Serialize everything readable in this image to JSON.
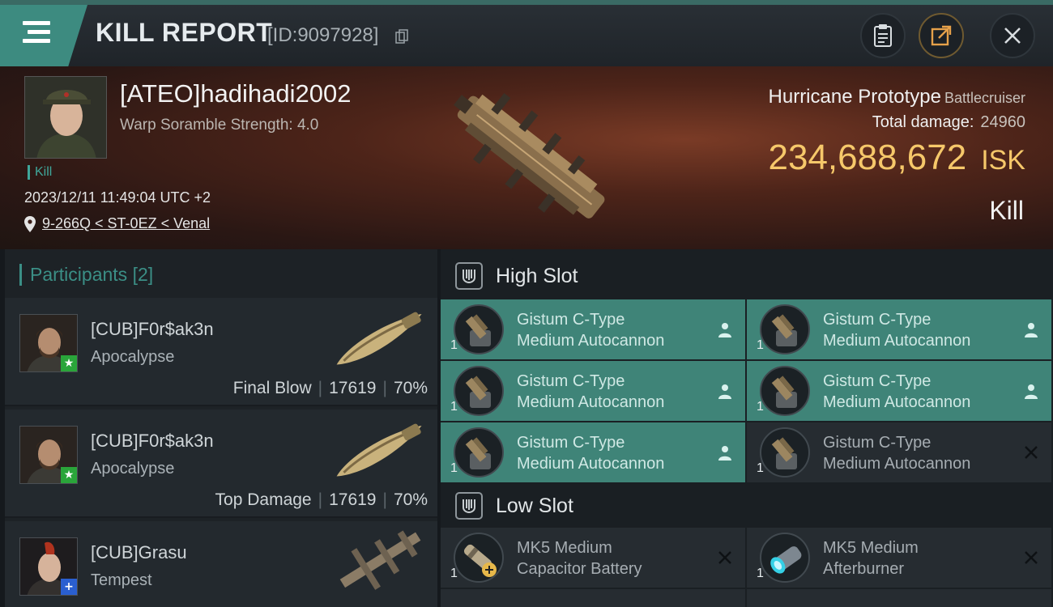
{
  "header": {
    "title": "KILL REPORT",
    "report_id": "[ID:9097928]"
  },
  "victim": {
    "name": "[ATEO]hadihadi2002",
    "warp_scramble": "Warp Soramble Strength: 4.0",
    "kill_tag": "Kill",
    "datetime": "2023/12/11 11:49:04 UTC +2",
    "location": "9-266Q < ST-0EZ < Venal",
    "ship_name": "Hurricane Prototype",
    "ship_class": "Battlecruiser",
    "total_damage_label": "Total damage:",
    "total_damage_value": "24960",
    "isk_value": "234,688,672",
    "isk_unit": "ISK",
    "result": "Kill"
  },
  "participants": {
    "title": "Participants",
    "count": "[2]",
    "items": [
      {
        "name": "[CUB]F0r$ak3n",
        "ship": "Apocalypse",
        "role": "Final Blow",
        "damage": "17619",
        "percent": "70%"
      },
      {
        "name": "[CUB]F0r$ak3n",
        "ship": "Apocalypse",
        "role": "Top Damage",
        "damage": "17619",
        "percent": "70%"
      },
      {
        "name": "[CUB]Grasu",
        "ship": "Tempest"
      }
    ],
    "separator": "|"
  },
  "fitting": {
    "high_slot_label": "High Slot",
    "low_slot_label": "Low Slot",
    "high": [
      {
        "line1": "Gistum C-Type",
        "line2": "Medium Autocannon",
        "qty": "1",
        "status": "fitted"
      },
      {
        "line1": "Gistum C-Type",
        "line2": "Medium Autocannon",
        "qty": "1",
        "status": "fitted"
      },
      {
        "line1": "Gistum C-Type",
        "line2": "Medium Autocannon",
        "qty": "1",
        "status": "fitted"
      },
      {
        "line1": "Gistum C-Type",
        "line2": "Medium Autocannon",
        "qty": "1",
        "status": "fitted"
      },
      {
        "line1": "Gistum C-Type",
        "line2": "Medium Autocannon",
        "qty": "1",
        "status": "fitted"
      },
      {
        "line1": "Gistum C-Type",
        "line2": "Medium Autocannon",
        "qty": "1",
        "status": "destroyed"
      }
    ],
    "low": [
      {
        "line1": "MK5 Medium",
        "line2": "Capacitor Battery",
        "qty": "1",
        "status": "destroyed"
      },
      {
        "line1": "MK5 Medium",
        "line2": "Afterburner",
        "qty": "1",
        "status": "destroyed"
      }
    ]
  },
  "colors": {
    "accent": "#3d8b80",
    "isk": "#f6c86a",
    "module_active": "#3f8478"
  },
  "icons": [
    "menu-icon",
    "copy-icon",
    "clipboard-icon",
    "share-icon",
    "close-icon",
    "location-pin-icon",
    "slot-icon",
    "person-icon",
    "x-icon"
  ]
}
